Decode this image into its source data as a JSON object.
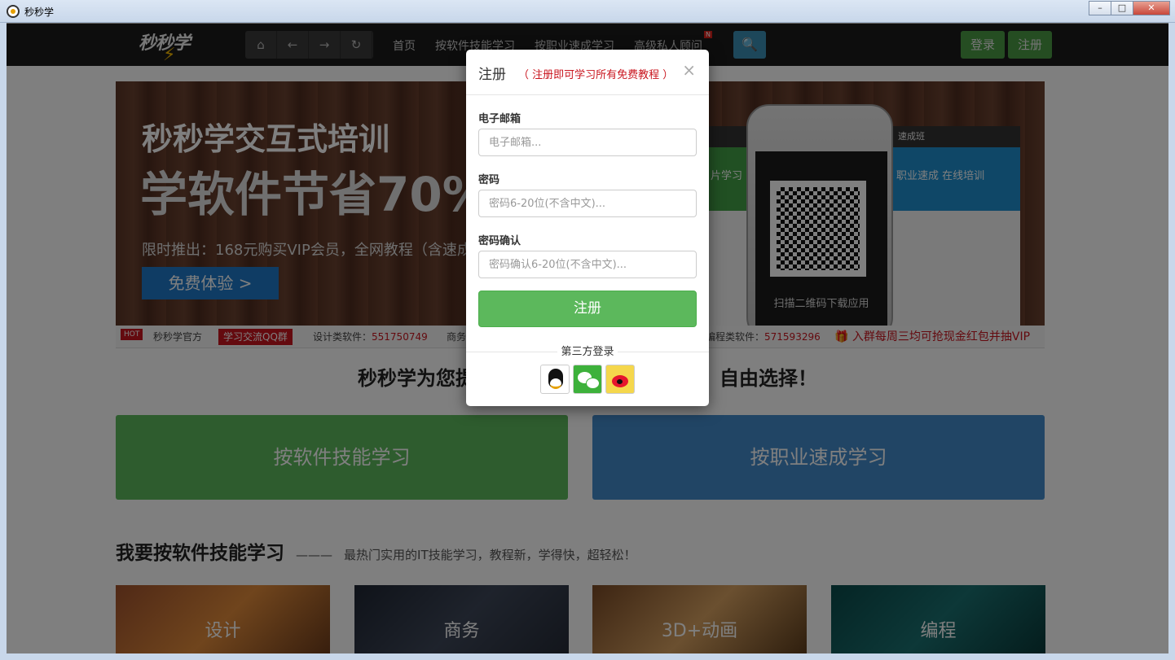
{
  "window": {
    "title": "秒秒学",
    "min": "–",
    "max": "□",
    "close": "✕"
  },
  "nav": {
    "logo": "秒秒学",
    "logo_bolt": "⚡",
    "tools": {
      "home": "⌂",
      "back": "←",
      "forward": "→",
      "refresh": "↻"
    },
    "links": [
      "首页",
      "按软件技能学习",
      "按职业速成学习",
      "高级私人顾问"
    ],
    "badge": "N",
    "search_icon": "🔍",
    "login": "登录",
    "register": "注册"
  },
  "banner": {
    "line1": "秒秒学交互式培训",
    "line2": "学软件节省70%",
    "promo": "限时推出：168元购买VIP会员，全网教程（含速成",
    "cta": "免费体验 >",
    "site_topbar": "速成班",
    "tile_a": "片学习",
    "tile_b": "职业速成 在线培训",
    "qr_caption": "扫描二维码下载应用"
  },
  "ticker": {
    "hot": "HOT",
    "official": "秒秒学官方",
    "qq_group": "学习交流QQ群",
    "design_label": "设计类软件：",
    "design_num": "551750749",
    "business_label": "商务",
    "program_label": "编程类软件：",
    "program_num": "571593296",
    "gift": "🎁 入群每周三均可抢现金红包并抽VIP"
  },
  "headline_left": "秒秒学为您提",
  "headline_right": "自由选择！",
  "big_buttons": {
    "software": "按软件技能学习",
    "career": "按职业速成学习"
  },
  "section": {
    "title": "我要按软件技能学习",
    "dash": "———",
    "subtitle": "最热门实用的IT技能学习，教程新，学得快，超轻松！"
  },
  "categories": [
    "设计",
    "商务",
    "3D+动画",
    "编程"
  ],
  "modal": {
    "title": "注册",
    "note": "（ 注册即可学习所有免费教程 ）",
    "close": "×",
    "email_label": "电子邮箱",
    "email_placeholder": "电子邮箱...",
    "password_label": "密码",
    "password_placeholder": "密码6-20位(不含中文)...",
    "confirm_label": "密码确认",
    "confirm_placeholder": "密码确认6-20位(不含中文)...",
    "submit": "注册",
    "third_party": "第三方登录"
  }
}
